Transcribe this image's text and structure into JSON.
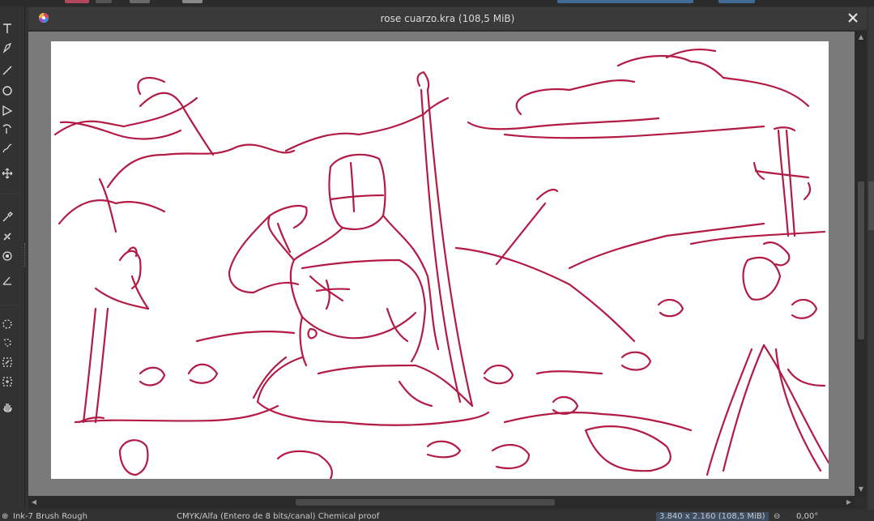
{
  "document": {
    "title": "rose cuarzo.kra (108,5 MiB)"
  },
  "status": {
    "brush": "Ink-7 Brush Rough",
    "color_space": "CMYK/Alfa (Entero de 8 bits/canal)  Chemical proof",
    "image_size": "3.840 x 2.160 (108,5 MiB)",
    "rotation": "0,00°"
  },
  "colors": {
    "sketch": "#b31b47",
    "canvas": "#ffffff",
    "viewport": "#7a7a7a",
    "chrome": "#323232",
    "accent": "#3d4e63"
  },
  "icons": {
    "app": "krita-logo-icon",
    "close": "close-icon",
    "tools": [
      "text-tool-icon",
      "calligraphy-tool-icon",
      "line-tool-icon",
      "ellipse-tool-icon",
      "polygon-tool-icon",
      "bezier-tool-icon",
      "freehand-path-tool-icon",
      "move-tool-icon",
      "color-picker-icon",
      "smart-patch-icon",
      "assistant-tool-icon",
      "measure-tool-icon",
      "ellipse-select-icon",
      "freehand-select-icon",
      "similar-select-icon",
      "magnetic-select-icon",
      "pan-tool-icon"
    ]
  }
}
